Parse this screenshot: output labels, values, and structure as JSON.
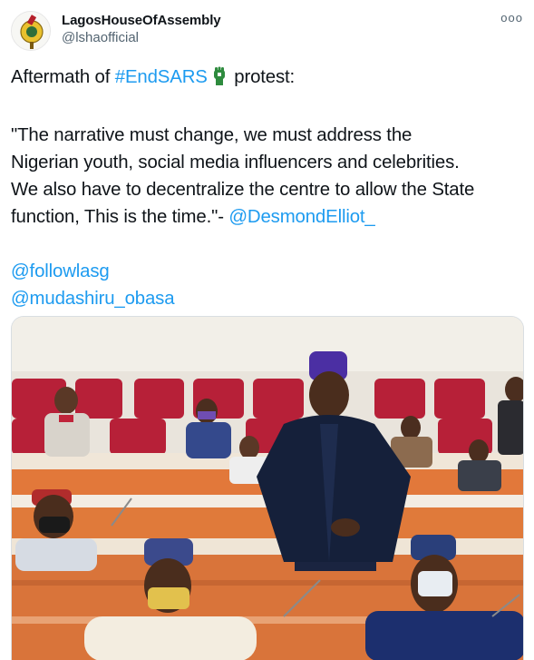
{
  "author": {
    "display_name": "LagosHouseOfAssembly",
    "handle": "@lshaofficial"
  },
  "more_label": "ooo",
  "tweet": {
    "line1_prefix": "Aftermath of ",
    "hashtag": "#EndSARS",
    "line1_suffix": " protest:",
    "quote_lines": [
      "\"The narrative must change, we must address the",
      "Nigerian youth, social media influencers and celebrities.",
      "We also have to decentralize the centre to allow the State",
      "function, This is the time.\"- "
    ],
    "mention_quote": "@DesmondElliot_",
    "mentions": [
      "@followlasg",
      "@mudashiru_obasa"
    ]
  },
  "media": {
    "description_icon": "photo-of-assembly-chamber"
  },
  "colors": {
    "link": "#1d9bf0",
    "seat_red": "#c0243a",
    "desk_orange": "#e07a3a"
  }
}
